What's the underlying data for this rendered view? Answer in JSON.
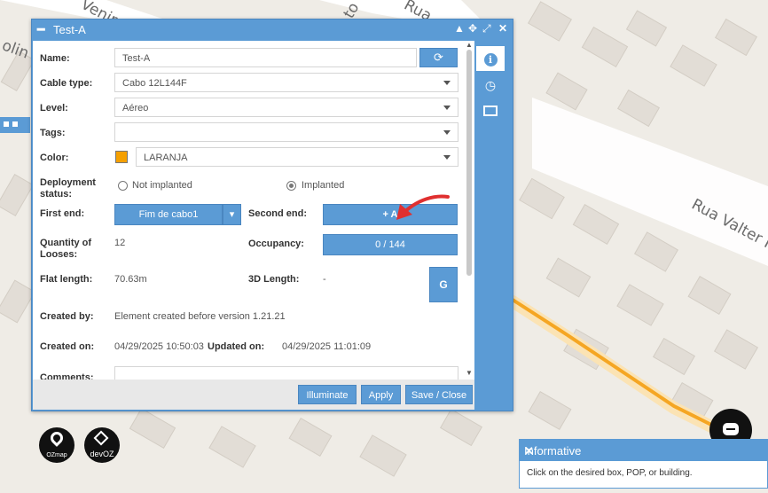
{
  "map": {
    "street_labels": [
      "Venir",
      "olin",
      "to",
      "Rua",
      "Rua Valter R"
    ],
    "cable_color": "#f5a623"
  },
  "dialog": {
    "title": "Test-A",
    "fields": {
      "name_label": "Name:",
      "name_value": "Test-A",
      "cable_type_label": "Cable type:",
      "cable_type_value": "Cabo 12L144F",
      "level_label": "Level:",
      "level_value": "Aéreo",
      "tags_label": "Tags:",
      "tags_value": "",
      "color_label": "Color:",
      "color_value": "LARANJA",
      "color_swatch": "#f5a000",
      "deployment_label": "Deployment status:",
      "deployment_options": [
        "Not implanted",
        "Implanted"
      ],
      "deployment_selected": "Implanted",
      "first_end_label": "First end:",
      "first_end_value": "Fim de cabo1",
      "second_end_label": "Second end:",
      "second_end_button": "+ A",
      "quantity_label": "Quantity of Looses:",
      "quantity_value": "12",
      "occupancy_label": "Occupancy:",
      "occupancy_value": "0 / 144",
      "flat_length_label": "Flat length:",
      "flat_length_value": "70.63m",
      "length_3d_label": "3D Length:",
      "length_3d_value": "-",
      "g_button": "G",
      "created_by_label": "Created by:",
      "created_by_value": "Element created before version 1.21.21",
      "created_on_label": "Created on:",
      "created_on_value": "04/29/2025 10:50:03",
      "updated_on_label": "Updated on:",
      "updated_on_value": "04/29/2025 11:01:09",
      "comments_label": "Comments:"
    },
    "footer": {
      "illuminate": "Illuminate",
      "apply": "Apply",
      "save_close": "Save / Close"
    },
    "side_tabs": [
      "info-icon",
      "clock-icon",
      "image-icon"
    ],
    "accent": "#5b9bd5"
  },
  "logos": {
    "ozmap": "OZmap",
    "devoz": "devOZ"
  },
  "informative": {
    "title": "Informative",
    "message": "Click on the desired box, POP, or building."
  }
}
